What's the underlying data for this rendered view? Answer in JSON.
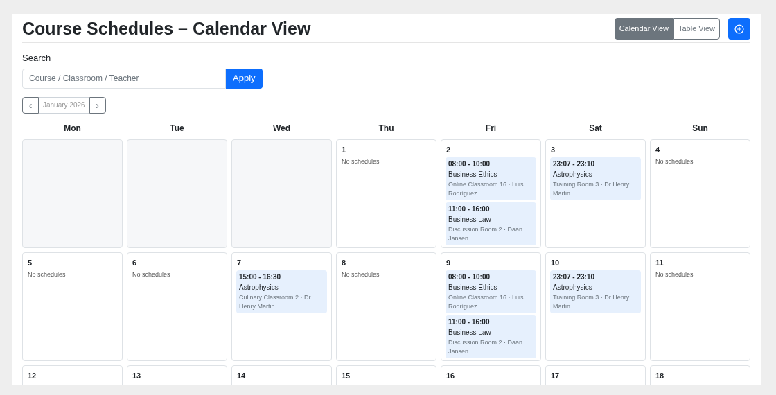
{
  "title": "Course Schedules – Calendar View",
  "view_toggle": [
    {
      "label": "Calendar View",
      "selected": true
    },
    {
      "label": "Table View",
      "selected": false
    }
  ],
  "search": {
    "label": "Search",
    "placeholder": "Course / Classroom / Teacher",
    "button": "Apply"
  },
  "month_nav": {
    "prev": "‹",
    "month": "January 2026",
    "next": "›"
  },
  "weekdays": [
    "Mon",
    "Tue",
    "Wed",
    "Thu",
    "Fri",
    "Sat",
    "Sun"
  ],
  "weeks": [
    [
      {
        "kind": "blank"
      },
      {
        "kind": "blank"
      },
      {
        "kind": "blank"
      },
      {
        "kind": "day",
        "number": "1",
        "empty_text": "No schedules"
      },
      {
        "kind": "day",
        "number": "2",
        "events": [
          {
            "time": "08:00 - 10:00",
            "course": "Business Ethics",
            "details": "Online Classroom 16 · Luis Rodríguez"
          },
          {
            "time": "11:00 - 16:00",
            "course": "Business Law",
            "details": "Discussion Room 2 · Daan Jansen"
          }
        ]
      },
      {
        "kind": "day",
        "number": "3",
        "events": [
          {
            "time": "23:07 - 23:10",
            "course": "Astrophysics",
            "details": "Training Room 3 · Dr Henry Martin"
          }
        ]
      },
      {
        "kind": "day",
        "number": "4",
        "empty_text": "No schedules"
      }
    ],
    [
      {
        "kind": "day",
        "number": "5",
        "empty_text": "No schedules"
      },
      {
        "kind": "day",
        "number": "6",
        "empty_text": "No schedules"
      },
      {
        "kind": "day",
        "number": "7",
        "events": [
          {
            "time": "15:00 - 16:30",
            "course": "Astrophysics",
            "details": "Culinary Classroom 2 · Dr Henry Martin"
          }
        ]
      },
      {
        "kind": "day",
        "number": "8",
        "empty_text": "No schedules"
      },
      {
        "kind": "day",
        "number": "9",
        "events": [
          {
            "time": "08:00 - 10:00",
            "course": "Business Ethics",
            "details": "Online Classroom 16 · Luis Rodríguez"
          },
          {
            "time": "11:00 - 16:00",
            "course": "Business Law",
            "details": "Discussion Room 2 · Daan Jansen"
          }
        ]
      },
      {
        "kind": "day",
        "number": "10",
        "events": [
          {
            "time": "23:07 - 23:10",
            "course": "Astrophysics",
            "details": "Training Room 3 · Dr Henry Martin"
          }
        ]
      },
      {
        "kind": "day",
        "number": "11",
        "empty_text": "No schedules"
      }
    ],
    [
      {
        "kind": "day",
        "number": "12"
      },
      {
        "kind": "day",
        "number": "13"
      },
      {
        "kind": "day",
        "number": "14"
      },
      {
        "kind": "day",
        "number": "15"
      },
      {
        "kind": "day",
        "number": "16"
      },
      {
        "kind": "day",
        "number": "17"
      },
      {
        "kind": "day",
        "number": "18"
      }
    ]
  ]
}
